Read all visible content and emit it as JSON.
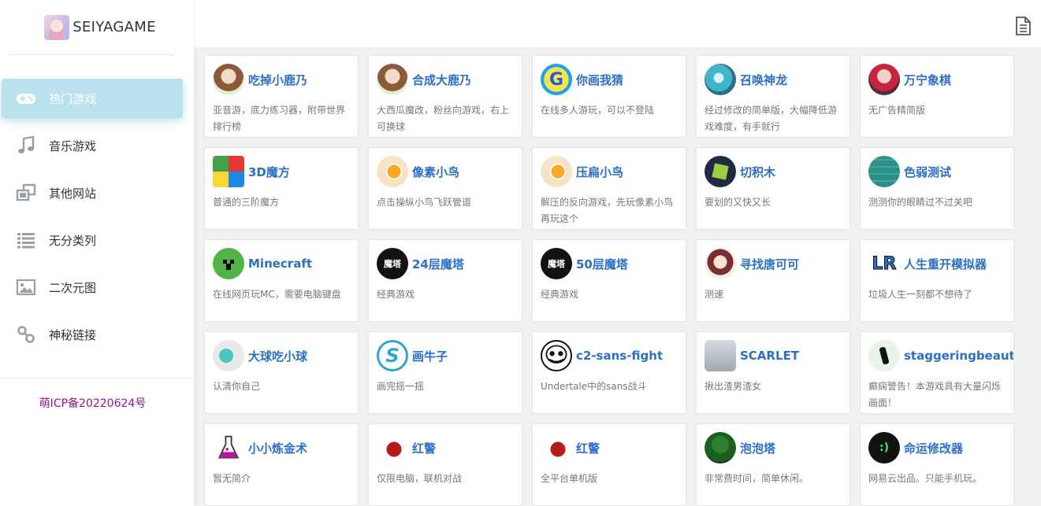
{
  "brand": {
    "name": "SEIYAGAME"
  },
  "sidebar": {
    "items": [
      {
        "label": "热门游戏",
        "icon": "gamepad-icon",
        "active": true
      },
      {
        "label": "音乐游戏",
        "icon": "music-note-icon",
        "active": false
      },
      {
        "label": "其他网站",
        "icon": "windows-icon",
        "active": false
      },
      {
        "label": "无分类列",
        "icon": "list-icon",
        "active": false
      },
      {
        "label": "二次元图",
        "icon": "image-icon",
        "active": false
      },
      {
        "label": "神秘链接",
        "icon": "link-icon",
        "active": false
      }
    ],
    "icp": "萌ICP备20220624号"
  },
  "topbar": {
    "icon": "document-icon"
  },
  "accent_color": "#b9e2ec",
  "title_color": "#2c6fc5",
  "cards": [
    {
      "title": "吃掉小鹿乃",
      "desc": "亚音游，底力练习器，附带世界排行榜",
      "icon": "girl-avatar-icon"
    },
    {
      "title": "合成大鹿乃",
      "desc": "大西瓜魔改，粉丝向游戏，右上可换球",
      "icon": "girl-avatar-icon"
    },
    {
      "title": "你画我猜",
      "desc": "在线多人游玩，可以不登陆",
      "icon": "g-logo-icon"
    },
    {
      "title": "召唤神龙",
      "desc": "经过修改的简单版，大幅降低游戏难度，有手就行",
      "icon": "dragon-icon"
    },
    {
      "title": "万宁象棋",
      "desc": "无广告精简版",
      "icon": "queen-avatar-icon"
    },
    {
      "title": "3D魔方",
      "desc": "普通的三阶魔方",
      "icon": "rubiks-cube-icon"
    },
    {
      "title": "像素小鸟",
      "desc": "点击操纵小鸟飞跃管道",
      "icon": "pixel-bird-icon"
    },
    {
      "title": "压扁小鸟",
      "desc": "解压的反向游戏，先玩像素小鸟再玩这个",
      "icon": "pixel-bird-icon"
    },
    {
      "title": "切积木",
      "desc": "要划的又快又长",
      "icon": "block-icon"
    },
    {
      "title": "色弱测试",
      "desc": "测测你的眼睛过不过关吧",
      "icon": "grid-icon"
    },
    {
      "title": "Minecraft",
      "desc": "在线网页玩MC，需要电脑键盘",
      "icon": "creeper-icon"
    },
    {
      "title": "24层魔塔",
      "desc": "经典游戏",
      "icon": "magic-tower-icon",
      "icon_text": "魔塔"
    },
    {
      "title": "50层魔塔",
      "desc": "经典游戏",
      "icon": "magic-tower-icon",
      "icon_text": "魔塔"
    },
    {
      "title": "寻找唐可可",
      "desc": "测速",
      "icon": "anime-girl-icon"
    },
    {
      "title": "人生重开模拟器",
      "desc": "垃圾人生一刻都不想待了",
      "icon": "lr-logo-icon",
      "icon_text": "LR"
    },
    {
      "title": "大球吃小球",
      "desc": "认清你自己",
      "icon": "balls-icon"
    },
    {
      "title": "画牛子",
      "desc": "画完摇一摇",
      "icon": "s-logo-icon",
      "icon_text": "S"
    },
    {
      "title": "c2-sans-fight",
      "desc": "Undertale中的sans战斗",
      "icon": "sans-skull-icon"
    },
    {
      "title": "SCARLET",
      "desc": "揪出渣男渣女",
      "icon": "scarlet-icon"
    },
    {
      "title": "staggeringbeauty",
      "desc": "癫痫警告！本游戏具有大量闪烁画面！",
      "icon": "worm-icon"
    },
    {
      "title": "小小炼金术",
      "desc": "暂无简介",
      "icon": "flask-icon"
    },
    {
      "title": "红警",
      "desc": "仅限电脑，联机对战",
      "icon": "red-alert-icon"
    },
    {
      "title": "红警",
      "desc": "全平台单机版",
      "icon": "red-alert-icon"
    },
    {
      "title": "泡泡塔",
      "desc": "非常费时间，简单休闲。",
      "icon": "bubble-tower-icon"
    },
    {
      "title": "命运修改器",
      "desc": "网易云出品。只能手机玩。",
      "icon": "smiley-icon",
      "icon_text": ":)"
    }
  ]
}
